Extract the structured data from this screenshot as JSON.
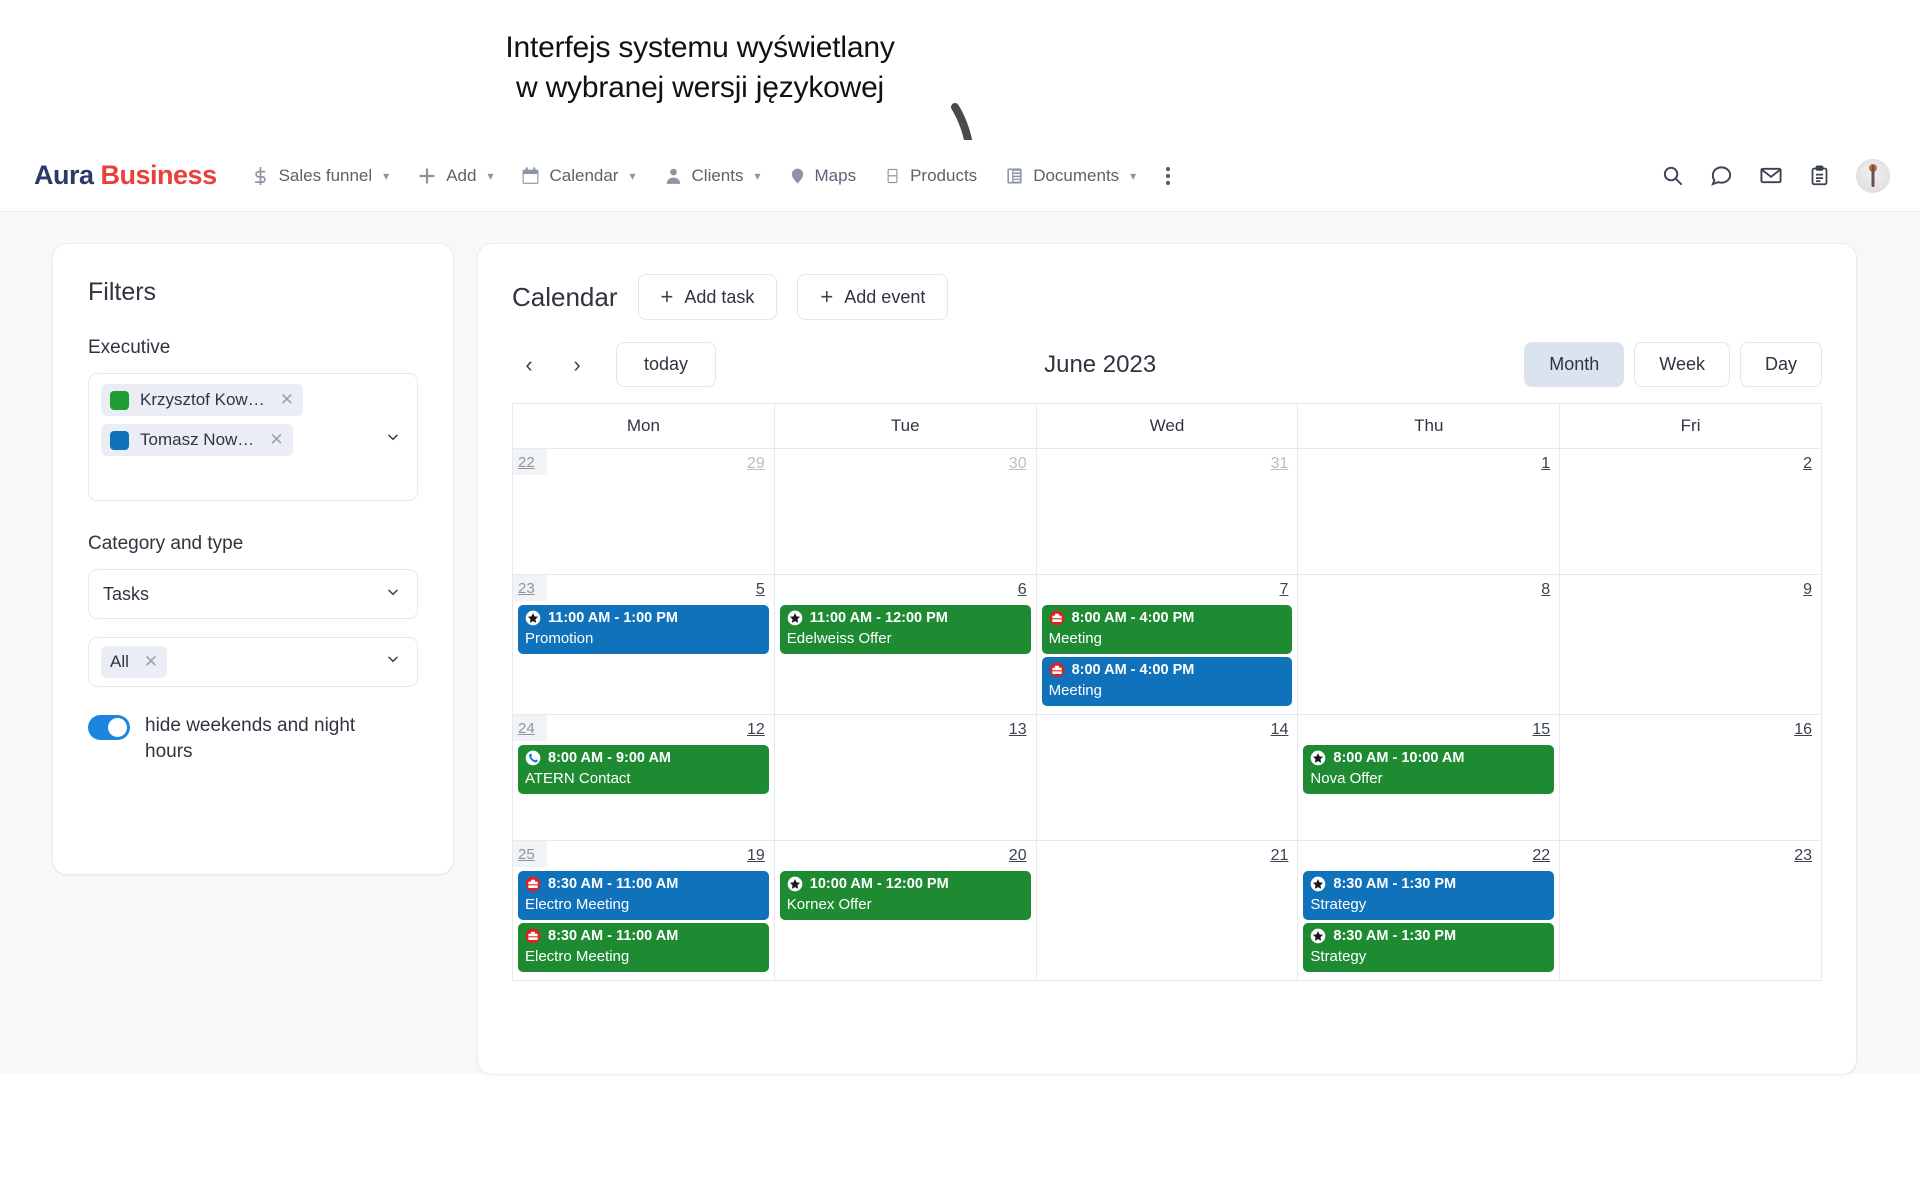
{
  "annotation": {
    "line1": "Interfejs systemu wyświetlany",
    "line2": "w wybranej wersji językowej"
  },
  "brand": {
    "first": "Aura",
    "second": "Business"
  },
  "colors": {
    "brand_first": "#2b3a67",
    "brand_second": "#e8403a",
    "event_blue": "#1072ba",
    "event_green": "#1e8b33",
    "toggle_on": "#1a86dd",
    "chip_bg": "#eaeef4",
    "active_view_bg": "#dbe3ef"
  },
  "nav": {
    "items": [
      {
        "label": "Sales funnel",
        "icon": "dollar-icon",
        "caret": true
      },
      {
        "label": "Add",
        "icon": "plus-icon",
        "caret": true
      },
      {
        "label": "Calendar",
        "icon": "calendar-icon",
        "caret": true
      },
      {
        "label": "Clients",
        "icon": "person-icon",
        "caret": true
      },
      {
        "label": "Maps",
        "icon": "map-pin-icon",
        "caret": false
      },
      {
        "label": "Products",
        "icon": "product-box-icon",
        "caret": false
      },
      {
        "label": "Documents",
        "icon": "documents-icon",
        "caret": true
      }
    ],
    "more_icon": "kebab-menu-icon",
    "right_icons": [
      "search-icon",
      "chat-icon",
      "mail-icon",
      "clipboard-icon",
      "avatar"
    ]
  },
  "sidebar": {
    "title": "Filters",
    "executive": {
      "label": "Executive",
      "chips": [
        {
          "name": "Krzysztof Kow…",
          "color": "#1f9c34"
        },
        {
          "name": "Tomasz Now…",
          "color": "#1072ba"
        }
      ]
    },
    "category": {
      "label": "Category and type",
      "type_value": "Tasks",
      "scope_chip": "All"
    },
    "toggle": {
      "label": "hide weekends and night hours",
      "on": true
    }
  },
  "calendar": {
    "title": "Calendar",
    "add_task": "Add task",
    "add_event": "Add event",
    "today": "today",
    "month_label": "June 2023",
    "views": [
      {
        "label": "Month",
        "active": true
      },
      {
        "label": "Week",
        "active": false
      },
      {
        "label": "Day",
        "active": false
      }
    ],
    "weekday_headers": [
      "Mon",
      "Tue",
      "Wed",
      "Thu",
      "Fri"
    ],
    "weeks": [
      {
        "week_number": "22",
        "days": [
          {
            "num": "29",
            "other_month": true,
            "events": []
          },
          {
            "num": "30",
            "other_month": true,
            "events": []
          },
          {
            "num": "31",
            "other_month": true,
            "events": []
          },
          {
            "num": "1",
            "other_month": false,
            "events": []
          },
          {
            "num": "2",
            "other_month": false,
            "events": []
          }
        ]
      },
      {
        "week_number": "23",
        "days": [
          {
            "num": "5",
            "other_month": false,
            "events": [
              {
                "time": "11:00 AM - 1:00 PM",
                "title": "Promotion",
                "color": "#1072ba",
                "icon": "star-icon"
              }
            ]
          },
          {
            "num": "6",
            "other_month": false,
            "events": [
              {
                "time": "11:00 AM - 12:00 PM",
                "title": "Edelweiss Offer",
                "color": "#1e8b33",
                "icon": "star-icon"
              }
            ]
          },
          {
            "num": "7",
            "other_month": false,
            "events": [
              {
                "time": "8:00 AM - 4:00 PM",
                "title": "Meeting",
                "color": "#1e8b33",
                "icon": "briefcase-icon"
              },
              {
                "time": "8:00 AM - 4:00 PM",
                "title": "Meeting",
                "color": "#1072ba",
                "icon": "briefcase-icon"
              }
            ]
          },
          {
            "num": "8",
            "other_month": false,
            "events": []
          },
          {
            "num": "9",
            "other_month": false,
            "events": []
          }
        ]
      },
      {
        "week_number": "24",
        "days": [
          {
            "num": "12",
            "other_month": false,
            "events": [
              {
                "time": "8:00 AM - 9:00 AM",
                "title": "ATERN Contact",
                "color": "#1e8b33",
                "icon": "phone-icon"
              }
            ]
          },
          {
            "num": "13",
            "other_month": false,
            "events": []
          },
          {
            "num": "14",
            "other_month": false,
            "events": []
          },
          {
            "num": "15",
            "other_month": false,
            "events": [
              {
                "time": "8:00 AM - 10:00 AM",
                "title": "Nova Offer",
                "color": "#1e8b33",
                "icon": "star-icon"
              }
            ]
          },
          {
            "num": "16",
            "other_month": false,
            "events": []
          }
        ]
      },
      {
        "week_number": "25",
        "days": [
          {
            "num": "19",
            "other_month": false,
            "events": [
              {
                "time": "8:30 AM - 11:00 AM",
                "title": "Electro Meeting",
                "color": "#1072ba",
                "icon": "briefcase-icon"
              },
              {
                "time": "8:30 AM - 11:00 AM",
                "title": "Electro Meeting",
                "color": "#1e8b33",
                "icon": "briefcase-icon"
              }
            ]
          },
          {
            "num": "20",
            "other_month": false,
            "events": [
              {
                "time": "10:00 AM - 12:00 PM",
                "title": "Kornex Offer",
                "color": "#1e8b33",
                "icon": "star-icon"
              }
            ]
          },
          {
            "num": "21",
            "other_month": false,
            "events": []
          },
          {
            "num": "22",
            "other_month": false,
            "events": [
              {
                "time": "8:30 AM - 1:30 PM",
                "title": "Strategy",
                "color": "#1072ba",
                "icon": "star-icon"
              },
              {
                "time": "8:30 AM - 1:30 PM",
                "title": "Strategy",
                "color": "#1e8b33",
                "icon": "star-icon"
              }
            ]
          },
          {
            "num": "23",
            "other_month": false,
            "events": []
          }
        ]
      }
    ]
  }
}
